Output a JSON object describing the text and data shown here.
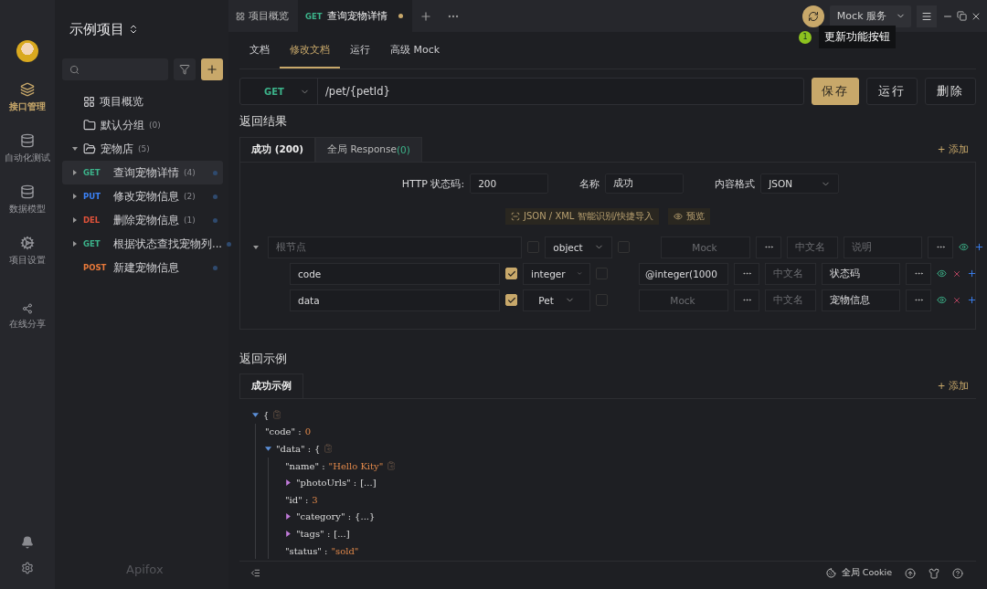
{
  "rail": {
    "items": [
      {
        "label": "接口管理",
        "kind": "api",
        "selected": true
      },
      {
        "label": "自动化测试",
        "kind": "test",
        "selected": false
      },
      {
        "label": "数据模型",
        "kind": "model",
        "selected": false
      },
      {
        "label": "项目设置",
        "kind": "settings",
        "selected": false
      },
      {
        "label": "在线分享",
        "kind": "share",
        "selected": false
      }
    ]
  },
  "sidebar": {
    "project_title": "示例项目",
    "brand": "Apifox",
    "tree": [
      {
        "kind": "overview",
        "label": "项目概览",
        "selected": false
      },
      {
        "kind": "folder",
        "label": "默认分组",
        "count": "(0)",
        "selected": false
      },
      {
        "kind": "folder",
        "label": "宠物店",
        "count": "(5)",
        "expanded": true,
        "selected": false,
        "children": [
          {
            "kind": "api",
            "method": "GET",
            "color": "#3cb38a",
            "label": "查询宠物详情",
            "count": "(4)",
            "expanded": false,
            "selected": true
          },
          {
            "kind": "api",
            "method": "PUT",
            "color": "#3b82f6",
            "label": "修改宠物信息",
            "count": "(2)",
            "expanded": false,
            "selected": false
          },
          {
            "kind": "api",
            "method": "DEL",
            "color": "#e0523a",
            "label": "删除宠物信息",
            "count": "(1)",
            "expanded": false,
            "selected": false
          },
          {
            "kind": "api",
            "method": "GET",
            "color": "#3cb38a",
            "label": "根据状态查找宠物列...",
            "expanded": false,
            "selected": false
          },
          {
            "kind": "api",
            "method": "POST",
            "color": "#e8793a",
            "label": "新建宠物信息",
            "selected": false
          }
        ]
      }
    ]
  },
  "top_tabs": [
    {
      "kind": "overview",
      "label": "项目概览",
      "selected": false
    },
    {
      "kind": "api",
      "method": "GET",
      "label": "查询宠物详情",
      "selected": true,
      "unsaved": true
    }
  ],
  "mock_service": "Mock 服务",
  "tooltip": {
    "badge": "1",
    "text": "更新功能按钮"
  },
  "sub_tabs": [
    {
      "label": "文档",
      "selected": false
    },
    {
      "label": "修改文档",
      "selected": true
    },
    {
      "label": "运行",
      "selected": false
    },
    {
      "label": "高级 Mock",
      "selected": false
    }
  ],
  "request": {
    "method": "GET",
    "path": "/pet/{petId}",
    "buttons": [
      {
        "label": "保存",
        "kind": "primary"
      },
      {
        "label": "运行",
        "kind": "default"
      },
      {
        "label": "删除",
        "kind": "default"
      }
    ]
  },
  "response": {
    "title": "返回结果",
    "add": "+ 添加",
    "tabs": [
      {
        "label": "成功 (200)",
        "selected": true
      },
      {
        "label": "全局 Response",
        "count": "(0)",
        "selected": false
      }
    ],
    "status_label": "HTTP 状态码:",
    "status_value": "200",
    "name_label": "名称",
    "name_value": "成功",
    "format_label": "内容格式",
    "format_value": "JSON",
    "tools": [
      {
        "kind": "import",
        "label": "JSON / XML 智能识别/快捷导入"
      },
      {
        "kind": "preview",
        "label": "预览"
      }
    ],
    "schema": [
      {
        "root": true,
        "name_placeholder": "根节点",
        "required": false,
        "type": "object",
        "nullable": false,
        "mock_placeholder": "Mock",
        "title_placeholder": "中文名",
        "desc_placeholder": "说明"
      },
      {
        "root": false,
        "name": "code",
        "required": true,
        "type": "integer",
        "nullable": false,
        "mock": "@integer(1000",
        "title_placeholder": "中文名",
        "desc": "状态码"
      },
      {
        "root": false,
        "name": "data",
        "required": true,
        "type": "Pet",
        "nullable": false,
        "mock_placeholder": "Mock",
        "title_placeholder": "中文名",
        "desc": "宠物信息"
      }
    ]
  },
  "example": {
    "title": "返回示例",
    "add": "+ 添加",
    "tabs": [
      {
        "label": "成功示例",
        "selected": true
      }
    ],
    "tree": {
      "open": "{",
      "expanded": true,
      "children": [
        {
          "key": "\"code\" :",
          "value": "0"
        },
        {
          "key": "\"data\" :",
          "open": "{",
          "expanded": true,
          "children": [
            {
              "key": "\"name\" :",
              "value": "\"Hello Kity\"",
              "copy": true
            },
            {
              "key": "\"photoUrls\" :",
              "value": "[...]",
              "expanded": false,
              "plain": true
            },
            {
              "key": "\"id\" :",
              "value": "3"
            },
            {
              "key": "\"category\" :",
              "value": "{...}",
              "expanded": false,
              "plain": true
            },
            {
              "key": "\"tags\" :",
              "value": "[...]",
              "expanded": false,
              "plain": true
            },
            {
              "key": "\"status\" :",
              "value": "\"sold\""
            }
          ]
        }
      ]
    }
  },
  "footer": {
    "cookie": "全局 Cookie"
  }
}
